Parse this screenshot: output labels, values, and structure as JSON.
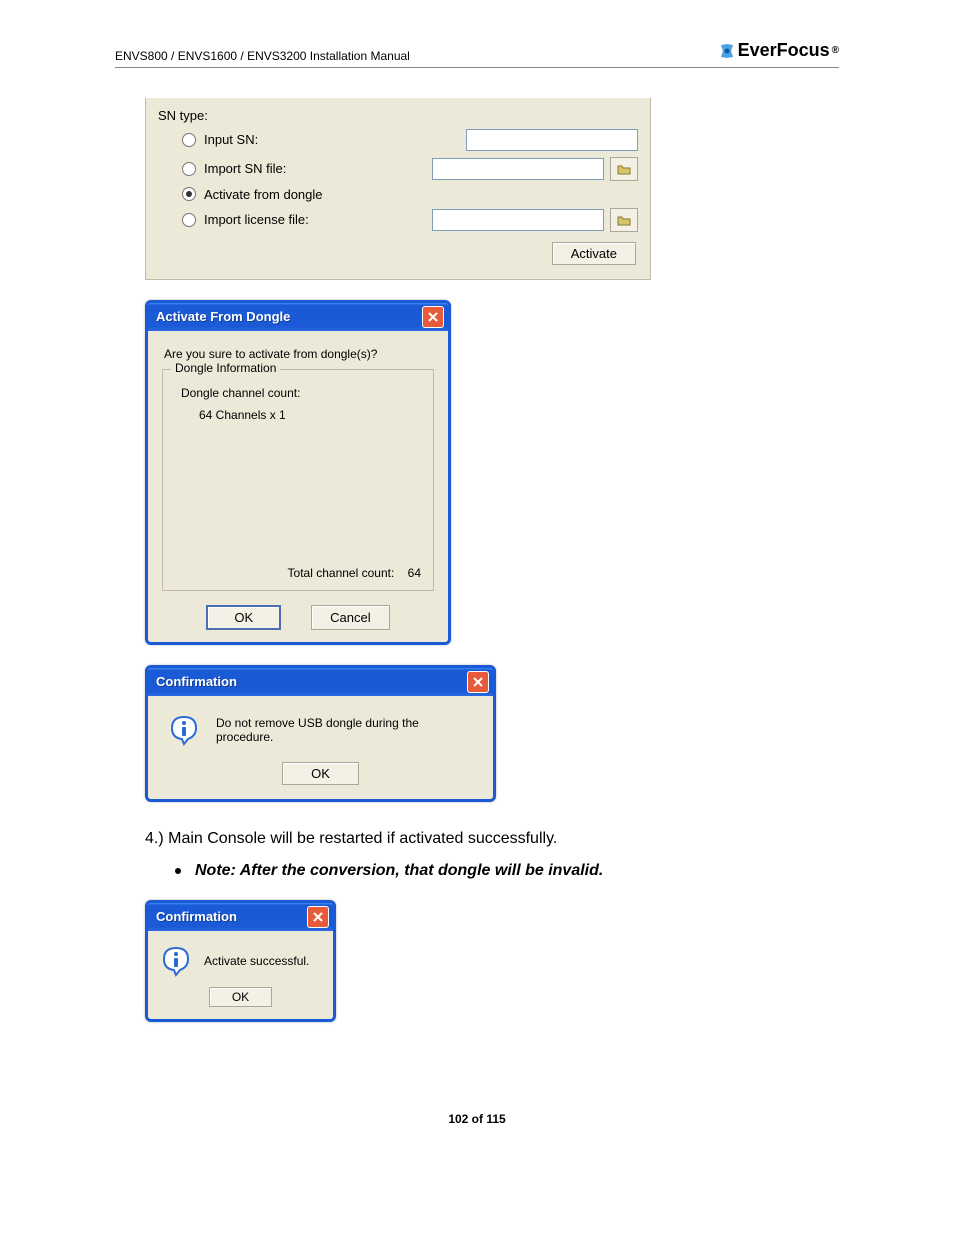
{
  "header": {
    "left": "ENVS800 / ENVS1600 / ENVS3200 Installation Manual",
    "brand": "EverFocus",
    "brand_mark": "®"
  },
  "sn_panel": {
    "label": "SN type:",
    "options": {
      "input_sn": "Input SN:",
      "import_sn_file": "Import SN file:",
      "activate_from_dongle": "Activate from dongle",
      "import_license_file": "Import license file:"
    },
    "activate_btn": "Activate"
  },
  "dlg_activate": {
    "title": "Activate From Dongle",
    "prompt": "Are you sure to activate from dongle(s)?",
    "group_title": "Dongle Information",
    "channel_label": "Dongle channel count:",
    "channel_value": "64 Channels x 1",
    "total_label": "Total channel count:",
    "total_value": "64",
    "ok": "OK",
    "cancel": "Cancel"
  },
  "dlg_confirm1": {
    "title": "Confirmation",
    "message": "Do not remove USB dongle during the procedure.",
    "ok": "OK"
  },
  "body_text": "4.) Main Console will be restarted if activated successfully.",
  "note_text": "Note: After the conversion, that dongle will be invalid.",
  "dlg_confirm2": {
    "title": "Confirmation",
    "message": "Activate successful.",
    "ok": "OK"
  },
  "footer": "102 of 115"
}
